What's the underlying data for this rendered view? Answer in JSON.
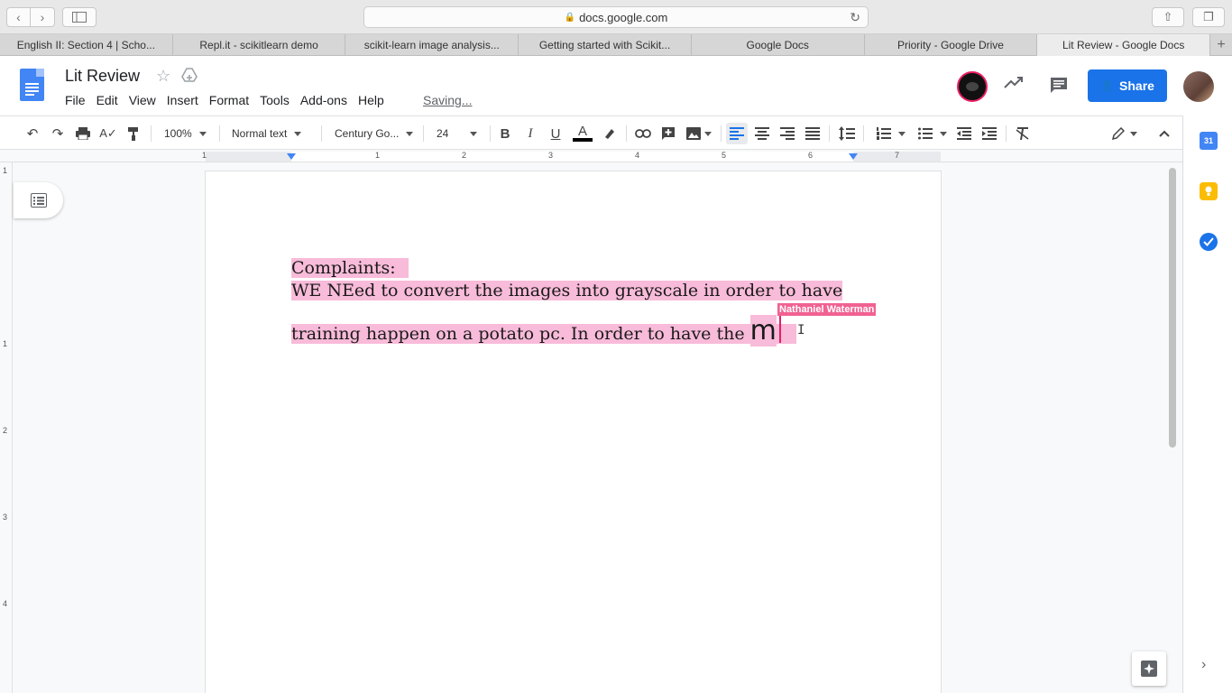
{
  "browser": {
    "url": "docs.google.com",
    "tabs": [
      {
        "label": "English II: Section 4 | Scho..."
      },
      {
        "label": "Repl.it - scikitlearn demo"
      },
      {
        "label": "scikit-learn image analysis..."
      },
      {
        "label": "Getting started with Scikit..."
      },
      {
        "label": "Google Docs"
      },
      {
        "label": "Priority - Google Drive"
      },
      {
        "label": "Lit Review - Google Docs"
      }
    ]
  },
  "docs": {
    "title": "Lit Review",
    "menu": [
      "File",
      "Edit",
      "View",
      "Insert",
      "Format",
      "Tools",
      "Add-ons",
      "Help"
    ],
    "status": "Saving...",
    "share_label": "Share"
  },
  "toolbar": {
    "zoom": "100%",
    "style": "Normal text",
    "font": "Century Go...",
    "size": "24",
    "bold": "B",
    "italic": "I",
    "underline": "U",
    "text_color_letter": "A"
  },
  "ruler": {
    "h_numbers": [
      "1",
      "1",
      "2",
      "3",
      "4",
      "5",
      "6",
      "7"
    ],
    "v_numbers": [
      "1",
      "1",
      "2",
      "3",
      "4"
    ]
  },
  "document": {
    "line1": "Complaints:",
    "line2": "WE NEed to convert the images into grayscale in order to have",
    "line3": "training happen on a potato pc. In order to have the ",
    "typed_char": "m",
    "collaborator": "Nathaniel Waterman"
  },
  "side_panel": {
    "calendar_day": "31"
  },
  "colors": {
    "accent": "#1a73e8",
    "highlight": "#f8bbd9",
    "collaborator": "#e91e63"
  }
}
